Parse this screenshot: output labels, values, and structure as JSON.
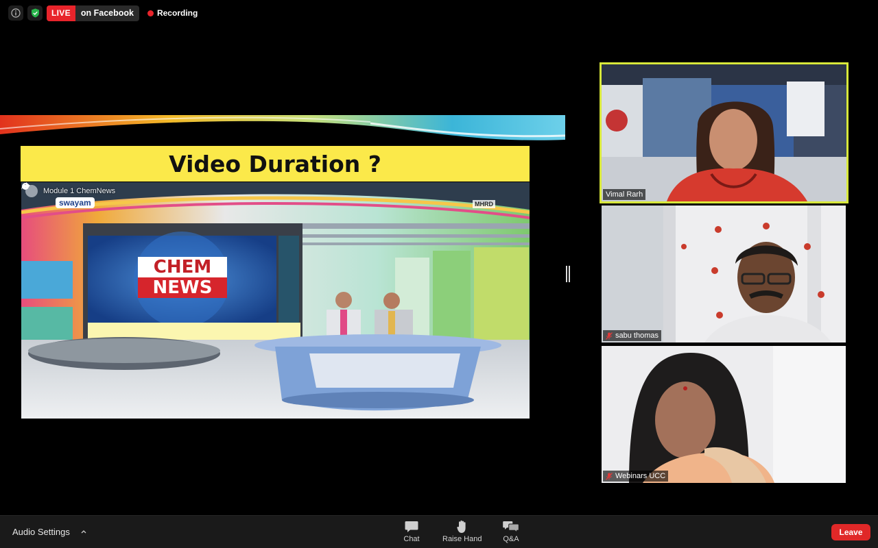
{
  "topbar": {
    "live_label": "LIVE",
    "live_platform": "on Facebook",
    "recording_label": "Recording",
    "icons": [
      "info-icon",
      "shield-check-icon",
      "record-dot-icon"
    ]
  },
  "shared_screen": {
    "slide_title": "Video Duration ?",
    "video_title": "Module 1 ChemNews",
    "logo_top": "CHEM",
    "logo_bottom": "NEWS",
    "channel_logo": "swayam",
    "ministry_logo": "MHRD"
  },
  "participants": [
    {
      "name": "Vimal Rarh",
      "active_speaker": true,
      "muted": false
    },
    {
      "name": "sabu thomas",
      "active_speaker": false,
      "muted": true
    },
    {
      "name": "Webinars UCC",
      "active_speaker": false,
      "muted": true
    }
  ],
  "toolbar": {
    "audio_settings_label": "Audio Settings",
    "chat_label": "Chat",
    "raise_hand_label": "Raise Hand",
    "qa_label": "Q&A",
    "leave_label": "Leave"
  },
  "colors": {
    "live_red": "#e8242b",
    "active_speaker_border": "#d8e83a",
    "slide_title_band": "#fbe94a",
    "leave_red": "#e02828"
  }
}
